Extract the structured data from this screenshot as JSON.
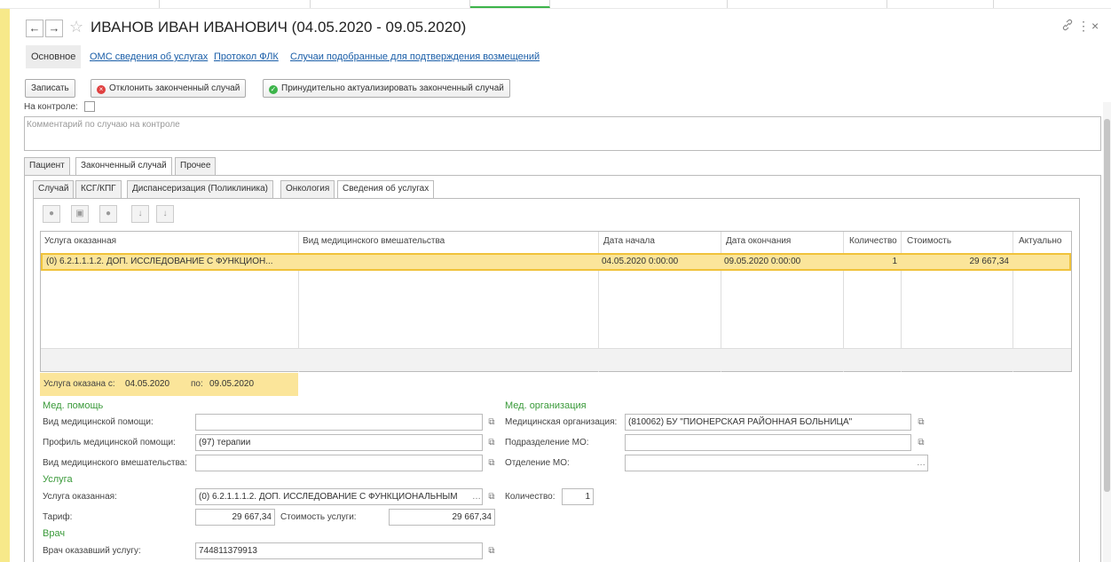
{
  "window": {
    "title": "ИВАНОВ ИВАН ИВАНОВИЧ (04.05.2020 - 09.05.2020)",
    "back_icon": "←",
    "forward_icon": "→",
    "star_icon": "☆",
    "link_icon": "🔗",
    "more_icon": "⋮",
    "close_icon": "×"
  },
  "top_tabs": [
    {
      "label": "Основное"
    },
    {
      "label": "ОМС сведения об услугах"
    },
    {
      "label": "Протокол ФЛК"
    },
    {
      "label": "Случаи подобранные для подтверждения возмещений"
    }
  ],
  "toolbar": {
    "save_label": "Записать",
    "reject_label": "Отклонить законченный случай",
    "actualize_label": "Принудительно актуализировать законченный случай"
  },
  "control": {
    "label": "На контроле:",
    "comment_placeholder": "Комментарий по случаю на контроле"
  },
  "tabs_level1": [
    {
      "label": "Пациент"
    },
    {
      "label": "Законченный случай"
    },
    {
      "label": "Прочее"
    }
  ],
  "tabs_level2": [
    {
      "label": "Случай"
    },
    {
      "label": "КСГ/КПГ"
    },
    {
      "label": "Диспансеризация (Поликлиника)"
    },
    {
      "label": "Онкология"
    },
    {
      "label": "Сведения об услугах"
    }
  ],
  "grid": {
    "columns": [
      "Услуга оказанная",
      "Вид медицинского вмешательства",
      "Дата начала",
      "Дата окончания",
      "Количество",
      "Стоимость",
      "Актуально"
    ],
    "row": {
      "service": "(0) 6.2.1.1.1.2. ДОП. ИССЛЕДОВАНИЕ С ФУНКЦИОН...",
      "intervention": "",
      "date_start": "04.05.2020 0:00:00",
      "date_end": "09.05.2020 0:00:00",
      "quantity": "1",
      "cost": "29 667,34",
      "actual": ""
    }
  },
  "period": {
    "from_label": "Услуга оказана с:",
    "from_value": "04.05.2020",
    "to_label": "по:",
    "to_value": "09.05.2020"
  },
  "med_help": {
    "group_label": "Мед. помощь",
    "kind_label": "Вид медицинской помощи:",
    "kind_value": "",
    "profile_label": "Профиль медицинской помощи:",
    "profile_value": "(97) терапии",
    "intervention_label": "Вид медицинского вмешательства:",
    "intervention_value": ""
  },
  "service": {
    "group_label": "Услуга",
    "service_label": "Услуга оказанная:",
    "service_value": "(0) 6.2.1.1.1.2. ДОП. ИССЛЕДОВАНИЕ С ФУНКЦИОНАЛЬНЫМ",
    "tariff_label": "Тариф:",
    "tariff_value": "29 667,34",
    "cost_label": "Стоимость услуги:",
    "cost_value": "29 667,34",
    "quantity_label": "Количество:",
    "quantity_value": "1"
  },
  "doctor": {
    "group_label": "Врач",
    "doctor_label": "Врач оказавший услугу:",
    "doctor_value": "744811379913"
  },
  "med_org": {
    "group_label": "Мед. организация",
    "org_label": "Медицинская организация:",
    "org_value": "(810062) БУ \"ПИОНЕРСКАЯ РАЙОННАЯ БОЛЬНИЦА\"",
    "division_label": "Подразделение МО:",
    "division_value": "",
    "department_label": "Отделение МО:",
    "department_value": ""
  },
  "colors": {
    "accent_link": "#1a5ea8",
    "group_green": "#3a9a3a",
    "row_highlight": "#fbe59a",
    "reject_red": "#e04040",
    "ok_green": "#3cb44a"
  }
}
